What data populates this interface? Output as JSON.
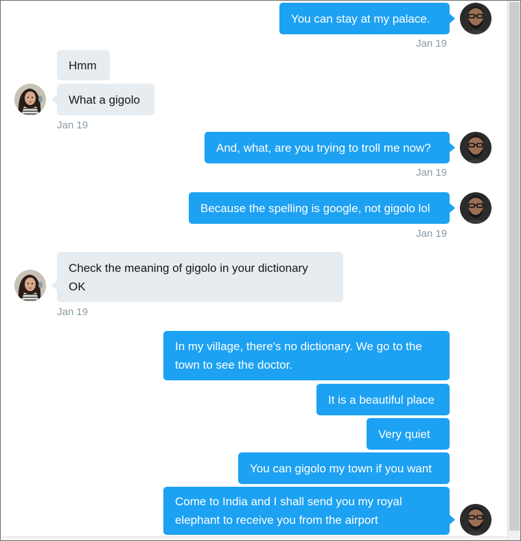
{
  "conversation": {
    "messages": [
      {
        "text": "You can stay at my palace.",
        "time": "Jan 19"
      },
      {
        "text": "Hmm"
      },
      {
        "text": "What a gigolo",
        "time": "Jan 19"
      },
      {
        "text": "And, what, are you trying to troll me now?",
        "time": "Jan 19"
      },
      {
        "text": "Because the spelling is google, not gigolo lol",
        "time": "Jan 19"
      },
      {
        "text": "Check the meaning of gigolo in your dictionary\nOK",
        "line1": "Check the meaning of gigolo in your dictionary",
        "line2": "OK",
        "time": "Jan 19"
      },
      {
        "line1": "In my village, there's no dictionary. We go to the",
        "line2": "town to see the doctor."
      },
      {
        "text": "It is a beautiful place"
      },
      {
        "text": "Very quiet"
      },
      {
        "text": "You can gigolo my town if you want"
      },
      {
        "line1": "Come to India and I shall send you my royal",
        "line2": "elephant to receive you from the airport"
      }
    ]
  },
  "colors": {
    "sent_bubble": "#1da1f2",
    "received_bubble": "#e6ecf0",
    "timestamp": "#8899a6"
  },
  "icons": {
    "sender_avatar": "avatar-man-glasses-beard",
    "receiver_avatar": "avatar-woman-dark-hair"
  }
}
